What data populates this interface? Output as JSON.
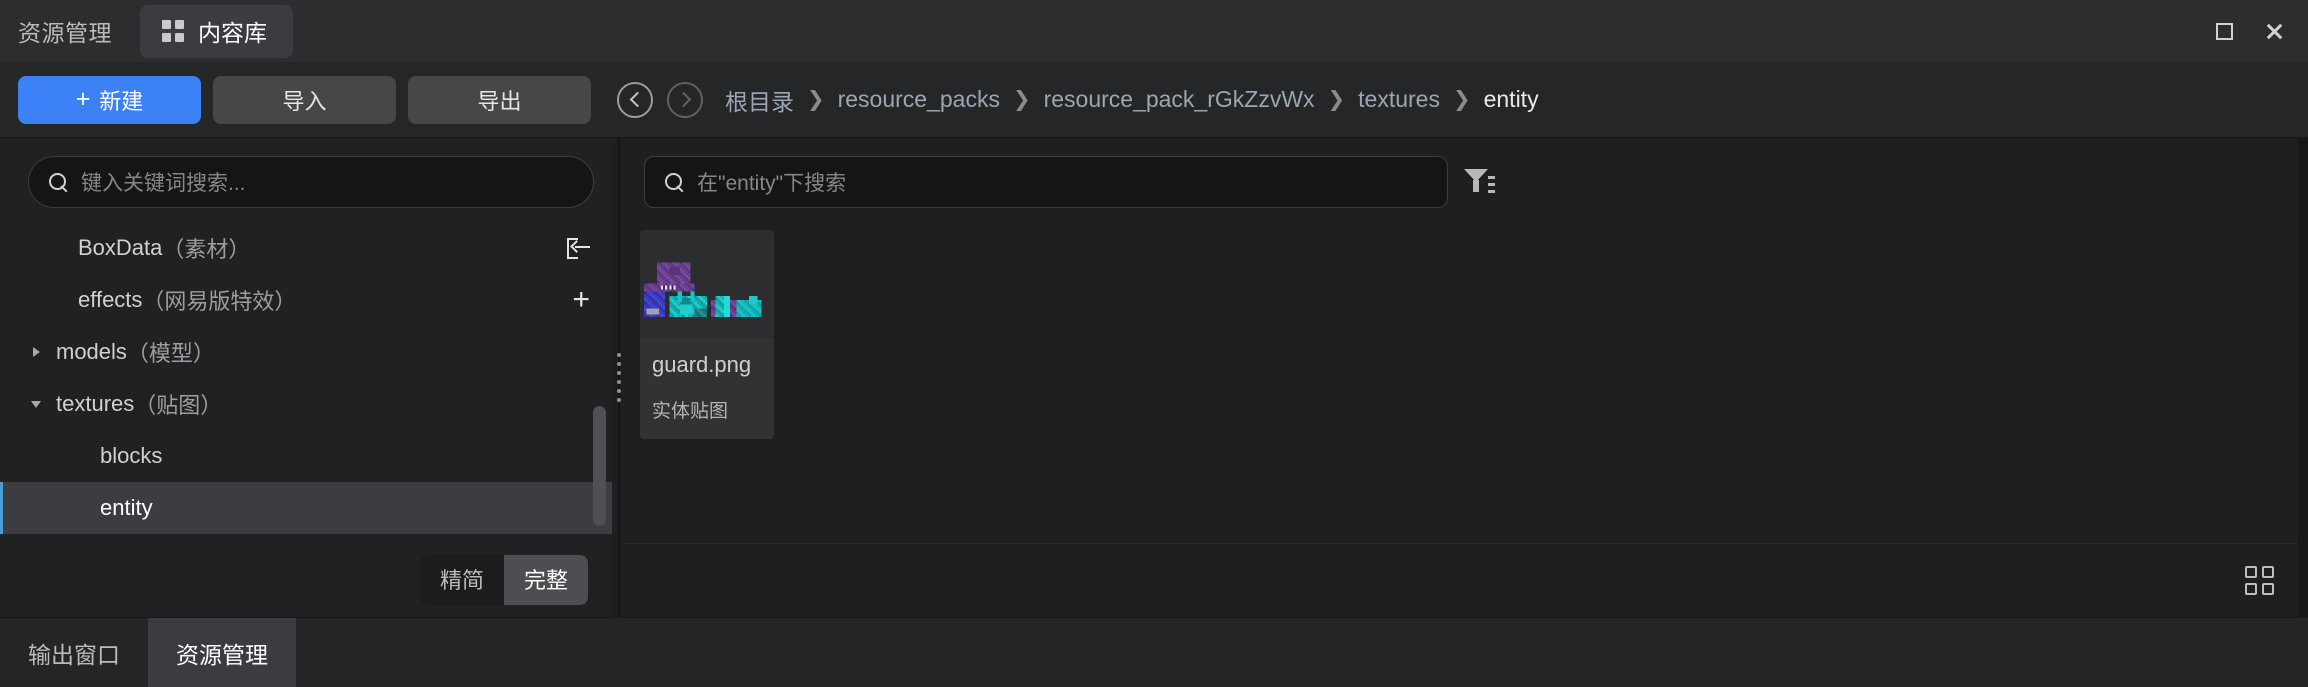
{
  "titlebar": {
    "app_label": "资源管理",
    "active_tab": "内容库",
    "tab_icon": "grid-4-icon",
    "controls": [
      {
        "name": "maximize-button",
        "icon": "square-icon"
      },
      {
        "name": "close-button",
        "icon": "close-icon"
      }
    ]
  },
  "toolbar": {
    "new_label": "新建",
    "new_prefix": "+",
    "import_label": "导入",
    "export_label": "导出",
    "back_icon": "chevron-left-circle-icon",
    "forward_icon": "chevron-right-circle-icon",
    "accent_color": "#3c82f6",
    "breadcrumb": [
      {
        "label": "根目录",
        "current": false
      },
      {
        "label": "resource_packs",
        "current": false
      },
      {
        "label": "resource_pack_rGkZzvWx",
        "current": false
      },
      {
        "label": "textures",
        "current": false
      },
      {
        "label": "entity",
        "current": true
      }
    ],
    "breadcrumb_separator": "❯"
  },
  "left_panel": {
    "search": {
      "placeholder": "键入关键词搜索...",
      "value": "",
      "icon": "search-icon"
    },
    "tree": [
      {
        "label": "BoxData",
        "sub": "（素材）",
        "indent": 1,
        "expander": "none",
        "action": "export-icon",
        "selected": false
      },
      {
        "label": "effects",
        "sub": "（网易版特效）",
        "indent": 1,
        "expander": "none",
        "action": "plus-icon",
        "selected": false
      },
      {
        "label": "models",
        "sub": "（模型）",
        "indent": 0,
        "expander": "collapsed",
        "action": "none",
        "selected": false
      },
      {
        "label": "textures",
        "sub": "（贴图）",
        "indent": 0,
        "expander": "expanded",
        "action": "none",
        "selected": false
      },
      {
        "label": "blocks",
        "sub": "",
        "indent": 2,
        "expander": "none",
        "action": "none",
        "selected": false
      },
      {
        "label": "entity",
        "sub": "",
        "indent": 2,
        "expander": "none",
        "action": "none",
        "selected": true
      }
    ],
    "view_modes": [
      {
        "label": "精简",
        "active": false
      },
      {
        "label": "完整",
        "active": true
      }
    ]
  },
  "right_panel": {
    "search": {
      "placeholder": "在\"entity\"下搜索",
      "value": "",
      "icon": "search-icon"
    },
    "filter_icon": "filter-funnel-icon",
    "items": [
      {
        "name": "guard.png",
        "type_label": "实体贴图",
        "thumbnail": "minecraft-entity-texture"
      }
    ],
    "view_toggle_icon": "grid-view-icon"
  },
  "bottom_tabs": [
    {
      "label": "输出窗口",
      "active": false
    },
    {
      "label": "资源管理",
      "active": true
    }
  ],
  "colors": {
    "window_bg": "#1e1f21",
    "titlebar_bg": "#2b2d2f",
    "panel_bg": "#202123",
    "accent_blue": "#3c82f6",
    "selection_bg": "#3b3d40",
    "selection_marker": "#4a9ed8",
    "breadcrumb_text": "#9ba6b3"
  }
}
